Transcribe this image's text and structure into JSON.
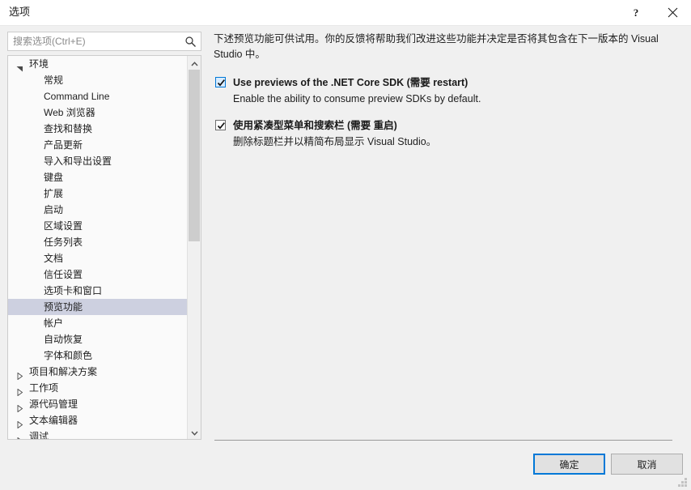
{
  "window": {
    "title": "选项",
    "help_icon": "question-mark-icon",
    "close_icon": "close-icon"
  },
  "search": {
    "placeholder": "搜索选项(Ctrl+E)",
    "value": "",
    "icon": "search-icon"
  },
  "tree": {
    "selected": "预览功能",
    "items": [
      {
        "label": "环境",
        "level": 0,
        "state": "expanded"
      },
      {
        "label": "常规",
        "level": 1,
        "state": "leaf"
      },
      {
        "label": "Command Line",
        "level": 1,
        "state": "leaf"
      },
      {
        "label": "Web 浏览器",
        "level": 1,
        "state": "leaf"
      },
      {
        "label": "查找和替换",
        "level": 1,
        "state": "leaf"
      },
      {
        "label": "产品更新",
        "level": 1,
        "state": "leaf"
      },
      {
        "label": "导入和导出设置",
        "level": 1,
        "state": "leaf"
      },
      {
        "label": "键盘",
        "level": 1,
        "state": "leaf"
      },
      {
        "label": "扩展",
        "level": 1,
        "state": "leaf"
      },
      {
        "label": "启动",
        "level": 1,
        "state": "leaf"
      },
      {
        "label": "区域设置",
        "level": 1,
        "state": "leaf"
      },
      {
        "label": "任务列表",
        "level": 1,
        "state": "leaf"
      },
      {
        "label": "文档",
        "level": 1,
        "state": "leaf"
      },
      {
        "label": "信任设置",
        "level": 1,
        "state": "leaf"
      },
      {
        "label": "选项卡和窗口",
        "level": 1,
        "state": "leaf"
      },
      {
        "label": "预览功能",
        "level": 1,
        "state": "leaf",
        "selected": true
      },
      {
        "label": "帐户",
        "level": 1,
        "state": "leaf"
      },
      {
        "label": "自动恢复",
        "level": 1,
        "state": "leaf"
      },
      {
        "label": "字体和颜色",
        "level": 1,
        "state": "leaf"
      },
      {
        "label": "项目和解决方案",
        "level": 0,
        "state": "collapsed"
      },
      {
        "label": "工作项",
        "level": 0,
        "state": "collapsed"
      },
      {
        "label": "源代码管理",
        "level": 0,
        "state": "collapsed"
      },
      {
        "label": "文本编辑器",
        "level": 0,
        "state": "collapsed"
      },
      {
        "label": "调试",
        "level": 0,
        "state": "collapsed"
      }
    ],
    "scrollbar": {
      "up_icon": "chevron-up-icon",
      "down_icon": "chevron-down-icon"
    }
  },
  "panel": {
    "intro": "下述预览功能可供试用。你的反馈将帮助我们改进这些功能并决定是否将其包含在下一版本的 Visual Studio 中。",
    "options": [
      {
        "title": "Use previews of the .NET Core SDK (需要 restart)",
        "description": "Enable the ability to consume preview SDKs by default.",
        "checked": true,
        "focused": true
      },
      {
        "title": "使用紧凑型菜单和搜索栏 (需要 重启)",
        "description": "删除标题栏并以精简布局显示 Visual Studio。",
        "checked": true,
        "focused": false
      }
    ]
  },
  "footer": {
    "ok_label": "确定",
    "cancel_label": "取消"
  },
  "colors": {
    "accent": "#0078d7",
    "selection": "#cdd0e0",
    "dialog_bg": "#f0f0f0",
    "tree_bg": "#fafafa",
    "scroll_thumb": "#cdcdcd"
  }
}
